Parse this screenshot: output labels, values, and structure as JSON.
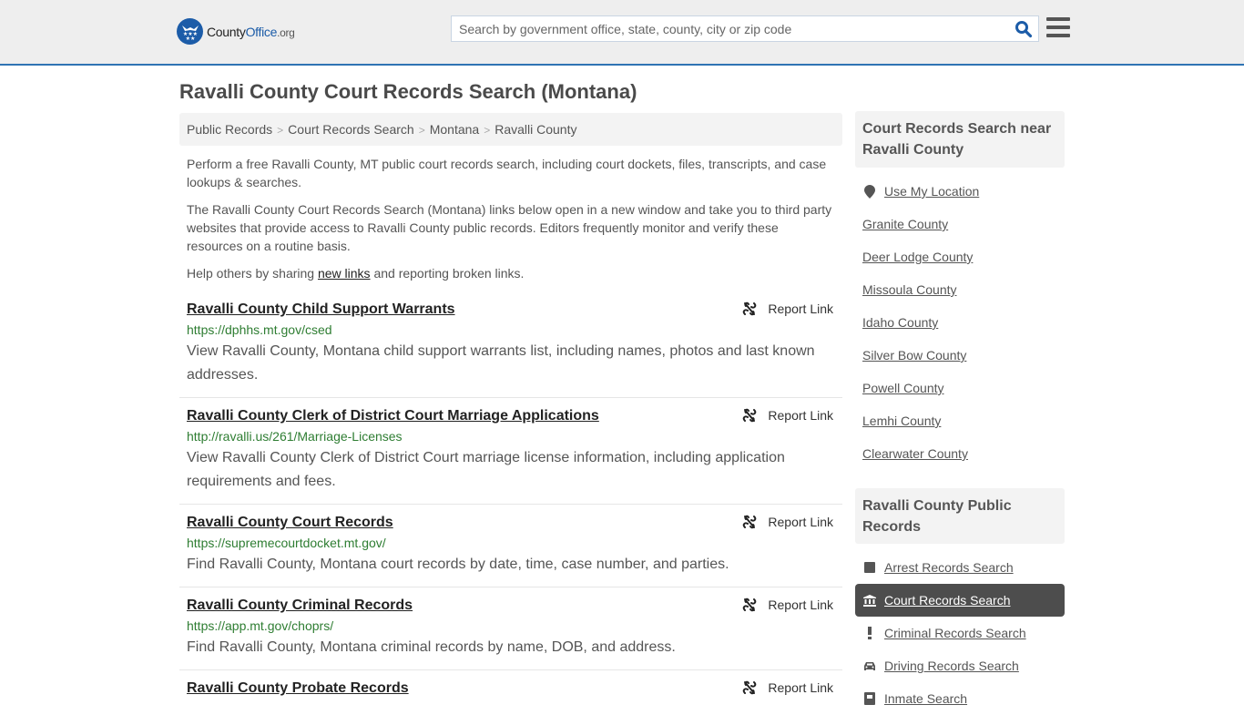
{
  "header": {
    "logo": {
      "part1": "County",
      "part2": "Office",
      "part3": ".org"
    },
    "search": {
      "placeholder": "Search by government office, state, county, city or zip code",
      "value": ""
    },
    "icons": {
      "logo": "eagle-badge-icon",
      "search": "search-icon",
      "menu": "hamburger-menu-icon"
    }
  },
  "page": {
    "title": "Ravalli County Court Records Search (Montana)"
  },
  "breadcrumb": [
    {
      "label": "Public Records"
    },
    {
      "label": "Court Records Search"
    },
    {
      "label": "Montana"
    },
    {
      "label": "Ravalli County"
    }
  ],
  "intro": {
    "p1": "Perform a free Ravalli County, MT public court records search, including court dockets, files, transcripts, and case lookups & searches.",
    "p2": "The Ravalli County Court Records Search (Montana) links below open in a new window and take you to third party websites that provide access to Ravalli County public records. Editors frequently monitor and verify these resources on a routine basis.",
    "p3_before": "Help others by sharing ",
    "p3_link": "new links",
    "p3_after": " and reporting broken links."
  },
  "report_label": "Report Link",
  "results": [
    {
      "title": "Ravalli County Child Support Warrants",
      "url": "https://dphhs.mt.gov/csed",
      "desc": "View Ravalli County, Montana child support warrants list, including names, photos and last known addresses."
    },
    {
      "title": "Ravalli County Clerk of District Court Marriage Applications",
      "url": "http://ravalli.us/261/Marriage-Licenses",
      "desc": "View Ravalli County Clerk of District Court marriage license information, including application requirements and fees."
    },
    {
      "title": "Ravalli County Court Records",
      "url": "https://supremecourtdocket.mt.gov/",
      "desc": "Find Ravalli County, Montana court records by date, time, case number, and parties."
    },
    {
      "title": "Ravalli County Criminal Records",
      "url": "https://app.mt.gov/choprs/",
      "desc": "Find Ravalli County, Montana criminal records by name, DOB, and address."
    },
    {
      "title": "Ravalli County Probate Records",
      "url": "",
      "desc": ""
    }
  ],
  "sidebar": {
    "nearby": {
      "heading": "Court Records Search near Ravalli County",
      "use_location": "Use My Location",
      "counties": [
        "Granite County",
        "Deer Lodge County",
        "Missoula County",
        "Idaho County",
        "Silver Bow County",
        "Powell County",
        "Lemhi County",
        "Clearwater County"
      ]
    },
    "public_records": {
      "heading": "Ravalli County Public Records",
      "items": [
        {
          "label": "Arrest Records Search",
          "icon": "square-icon",
          "active": false
        },
        {
          "label": "Court Records Search",
          "icon": "courthouse-icon",
          "active": true
        },
        {
          "label": "Criminal Records Search",
          "icon": "exclamation-icon",
          "active": false
        },
        {
          "label": "Driving Records Search",
          "icon": "car-icon",
          "active": false
        },
        {
          "label": "Inmate Search",
          "icon": "inmate-icon",
          "active": false
        }
      ]
    }
  },
  "colors": {
    "brand_blue": "#1c5ca8",
    "header_border": "#2f73b3",
    "url_green": "#2e7d32",
    "active_item_bg": "#4d4d4d"
  }
}
